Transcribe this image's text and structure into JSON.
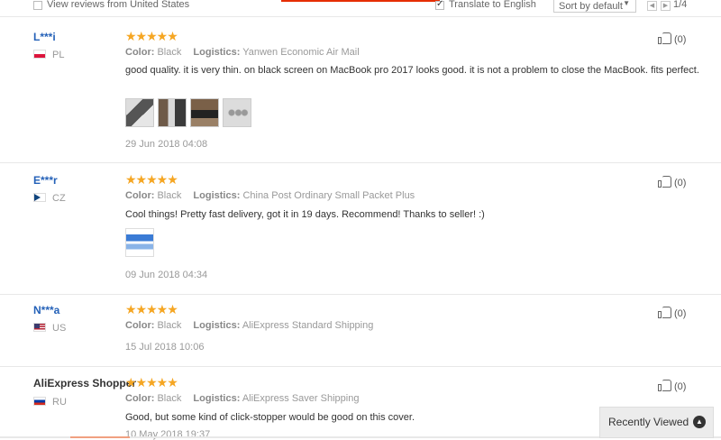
{
  "filters": {
    "view_us_label": "View reviews from United States",
    "translate_label": "Translate to English",
    "sort_label": "Sort by default",
    "page_indicator": "1/4"
  },
  "reviews": [
    {
      "name": "L***i",
      "country": "PL",
      "stars": "★★★★★",
      "color_key": "Color:",
      "color": "Black",
      "logistics_key": "Logistics:",
      "logistics": "Yanwen Economic Air Mail",
      "text": "good quality. it is very thin. on black screen on MacBook pro 2017 looks good. it is not a problem to close the MacBook. fits perfect.",
      "date": "29 Jun 2018 04:08",
      "likes": "(0)"
    },
    {
      "name": "E***r",
      "country": "CZ",
      "stars": "★★★★★",
      "color_key": "Color:",
      "color": "Black",
      "logistics_key": "Logistics:",
      "logistics": "China Post Ordinary Small Packet Plus",
      "text": "Cool things! Pretty fast delivery, got it in 19 days. Recommend! Thanks to seller! :)",
      "date": "09 Jun 2018 04:34",
      "likes": "(0)"
    },
    {
      "name": "N***a",
      "country": "US",
      "stars": "★★★★★",
      "color_key": "Color:",
      "color": "Black",
      "logistics_key": "Logistics:",
      "logistics": "AliExpress Standard Shipping",
      "date": "15 Jul 2018 10:06",
      "likes": "(0)"
    },
    {
      "name": "AliExpress Shopper",
      "country": "RU",
      "stars": "★★★★★",
      "color_key": "Color:",
      "color": "Black",
      "logistics_key": "Logistics:",
      "logistics": "AliExpress Saver Shipping",
      "text": "Good, but some kind of click-stopper would be good on this cover.",
      "date": "10 May 2018 19:37",
      "likes": "(0)"
    }
  ],
  "recently_viewed": {
    "label": "Recently Viewed"
  },
  "colors": {
    "star": "#f5a623",
    "name_link": "#2461b8",
    "accent": "#e62e04"
  }
}
